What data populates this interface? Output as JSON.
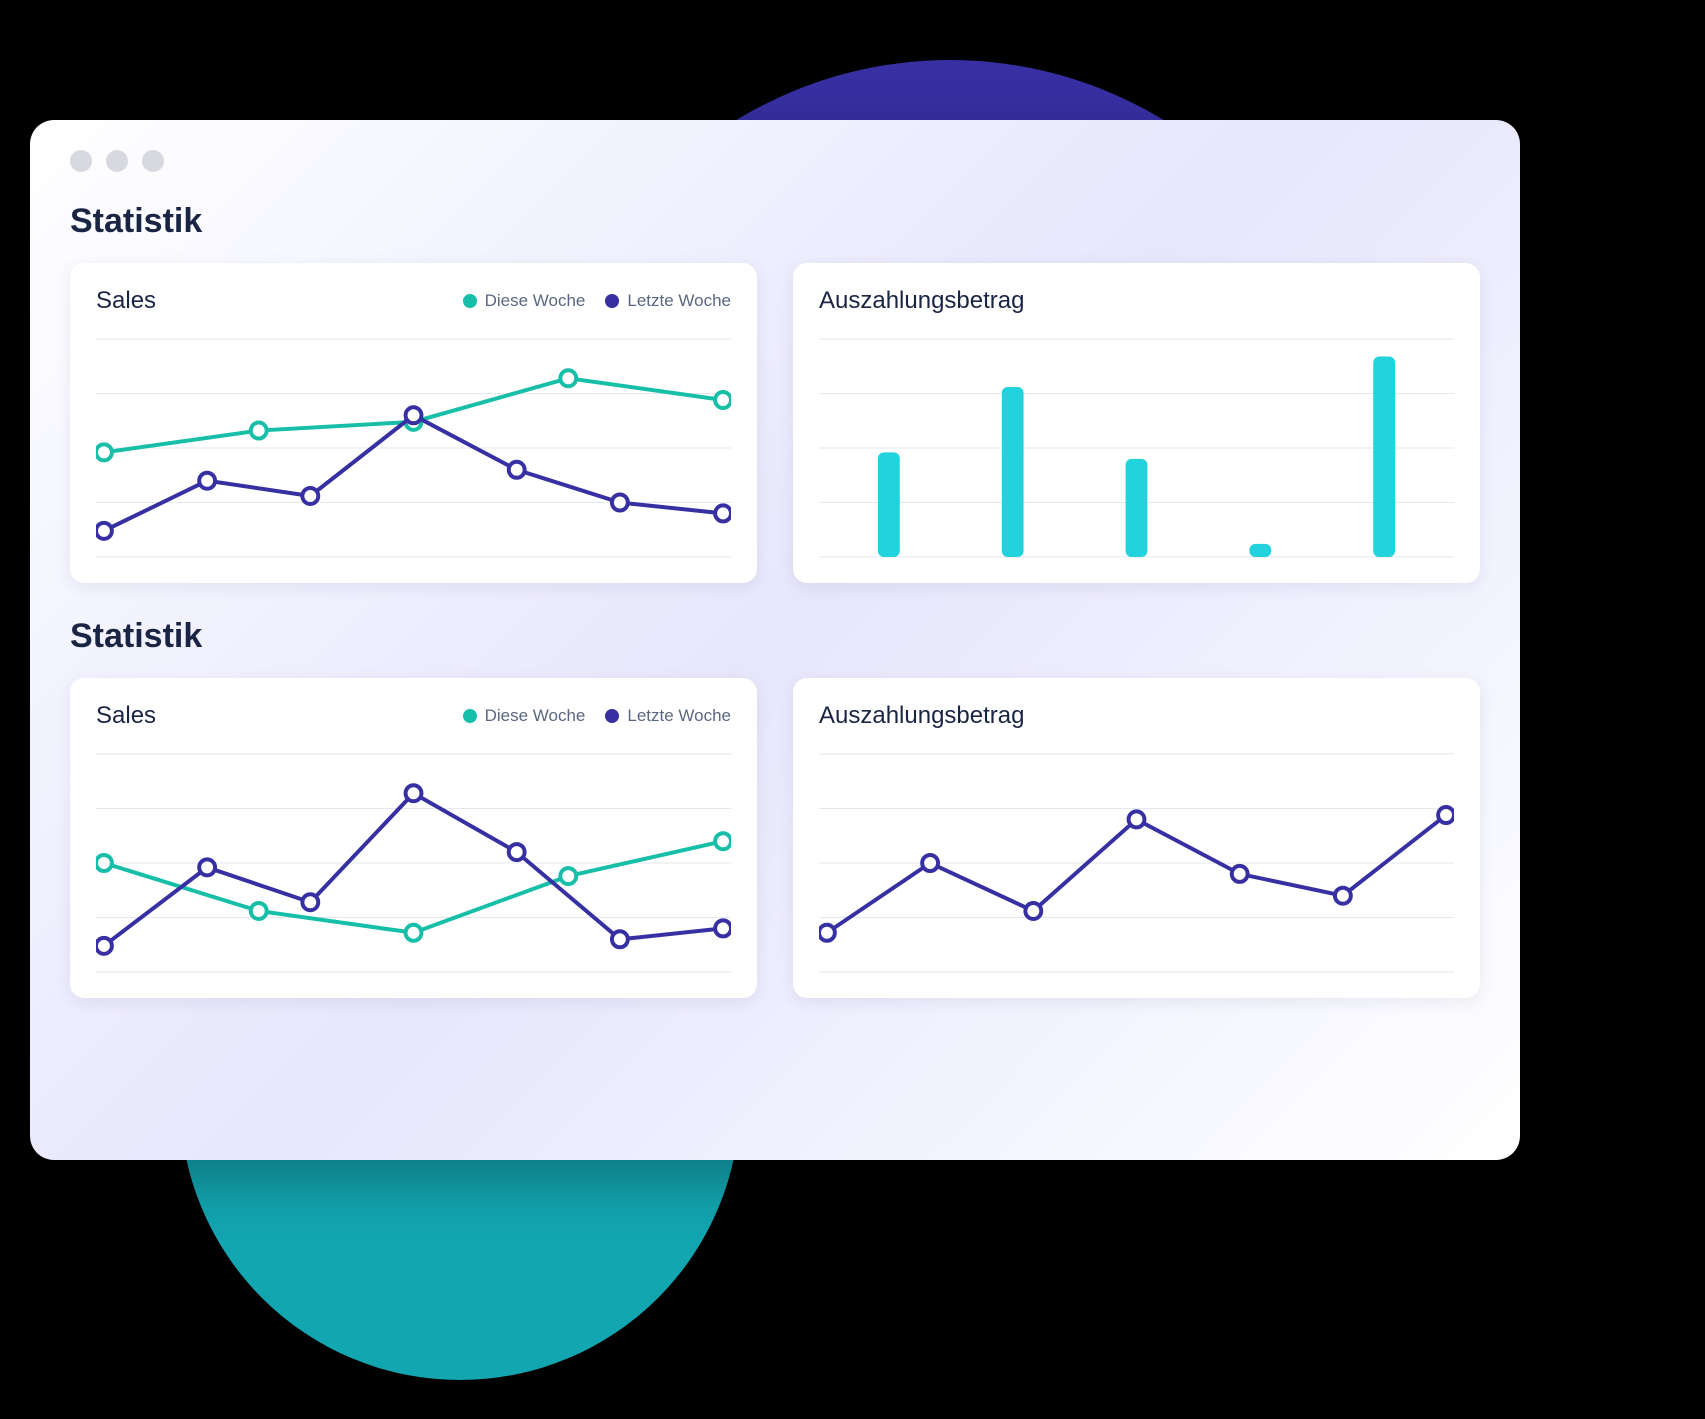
{
  "sections": [
    {
      "title": "Statistik"
    },
    {
      "title": "Statistik"
    }
  ],
  "cards": {
    "sales1": {
      "title": "Sales",
      "legend": [
        {
          "label": "Diese Woche",
          "color": "#18bfa8"
        },
        {
          "label": "Letzte Woche",
          "color": "#3730a3"
        }
      ]
    },
    "payout1": {
      "title": "Auszahlungsbetrag"
    },
    "sales2": {
      "title": "Sales",
      "legend": [
        {
          "label": "Diese Woche",
          "color": "#18bfa8"
        },
        {
          "label": "Letzte Woche",
          "color": "#3730a3"
        }
      ]
    },
    "payout2": {
      "title": "Auszahlungsbetrag"
    }
  },
  "colors": {
    "teal": "#18bfa8",
    "blue": "#3730a3",
    "barTeal": "#22d3dd"
  },
  "chart_data": [
    {
      "id": "sales1",
      "type": "line",
      "title": "Sales",
      "series": [
        {
          "name": "Diese Woche",
          "color": "#18bfa8",
          "values": [
            48,
            58,
            62,
            82,
            72
          ]
        },
        {
          "name": "Letzte Woche",
          "color": "#3730a3",
          "values": [
            12,
            35,
            28,
            65,
            40,
            25,
            20
          ]
        }
      ],
      "ylim": [
        0,
        100
      ],
      "gridlines": 5
    },
    {
      "id": "payout1",
      "type": "bar",
      "title": "Auszahlungsbetrag",
      "values": [
        48,
        78,
        45,
        6,
        92
      ],
      "color": "#22d3dd",
      "ylim": [
        0,
        100
      ],
      "gridlines": 5
    },
    {
      "id": "sales2",
      "type": "line",
      "title": "Sales",
      "series": [
        {
          "name": "Diese Woche",
          "color": "#18bfa8",
          "values": [
            50,
            28,
            18,
            44,
            60
          ]
        },
        {
          "name": "Letzte Woche",
          "color": "#3730a3",
          "values": [
            12,
            48,
            32,
            82,
            55,
            15,
            20
          ]
        }
      ],
      "ylim": [
        0,
        100
      ],
      "gridlines": 5
    },
    {
      "id": "payout2",
      "type": "line",
      "title": "Auszahlungsbetrag",
      "series": [
        {
          "name": "",
          "color": "#3730a3",
          "values": [
            18,
            50,
            28,
            70,
            45,
            35,
            72
          ]
        }
      ],
      "ylim": [
        0,
        100
      ],
      "gridlines": 5
    }
  ]
}
